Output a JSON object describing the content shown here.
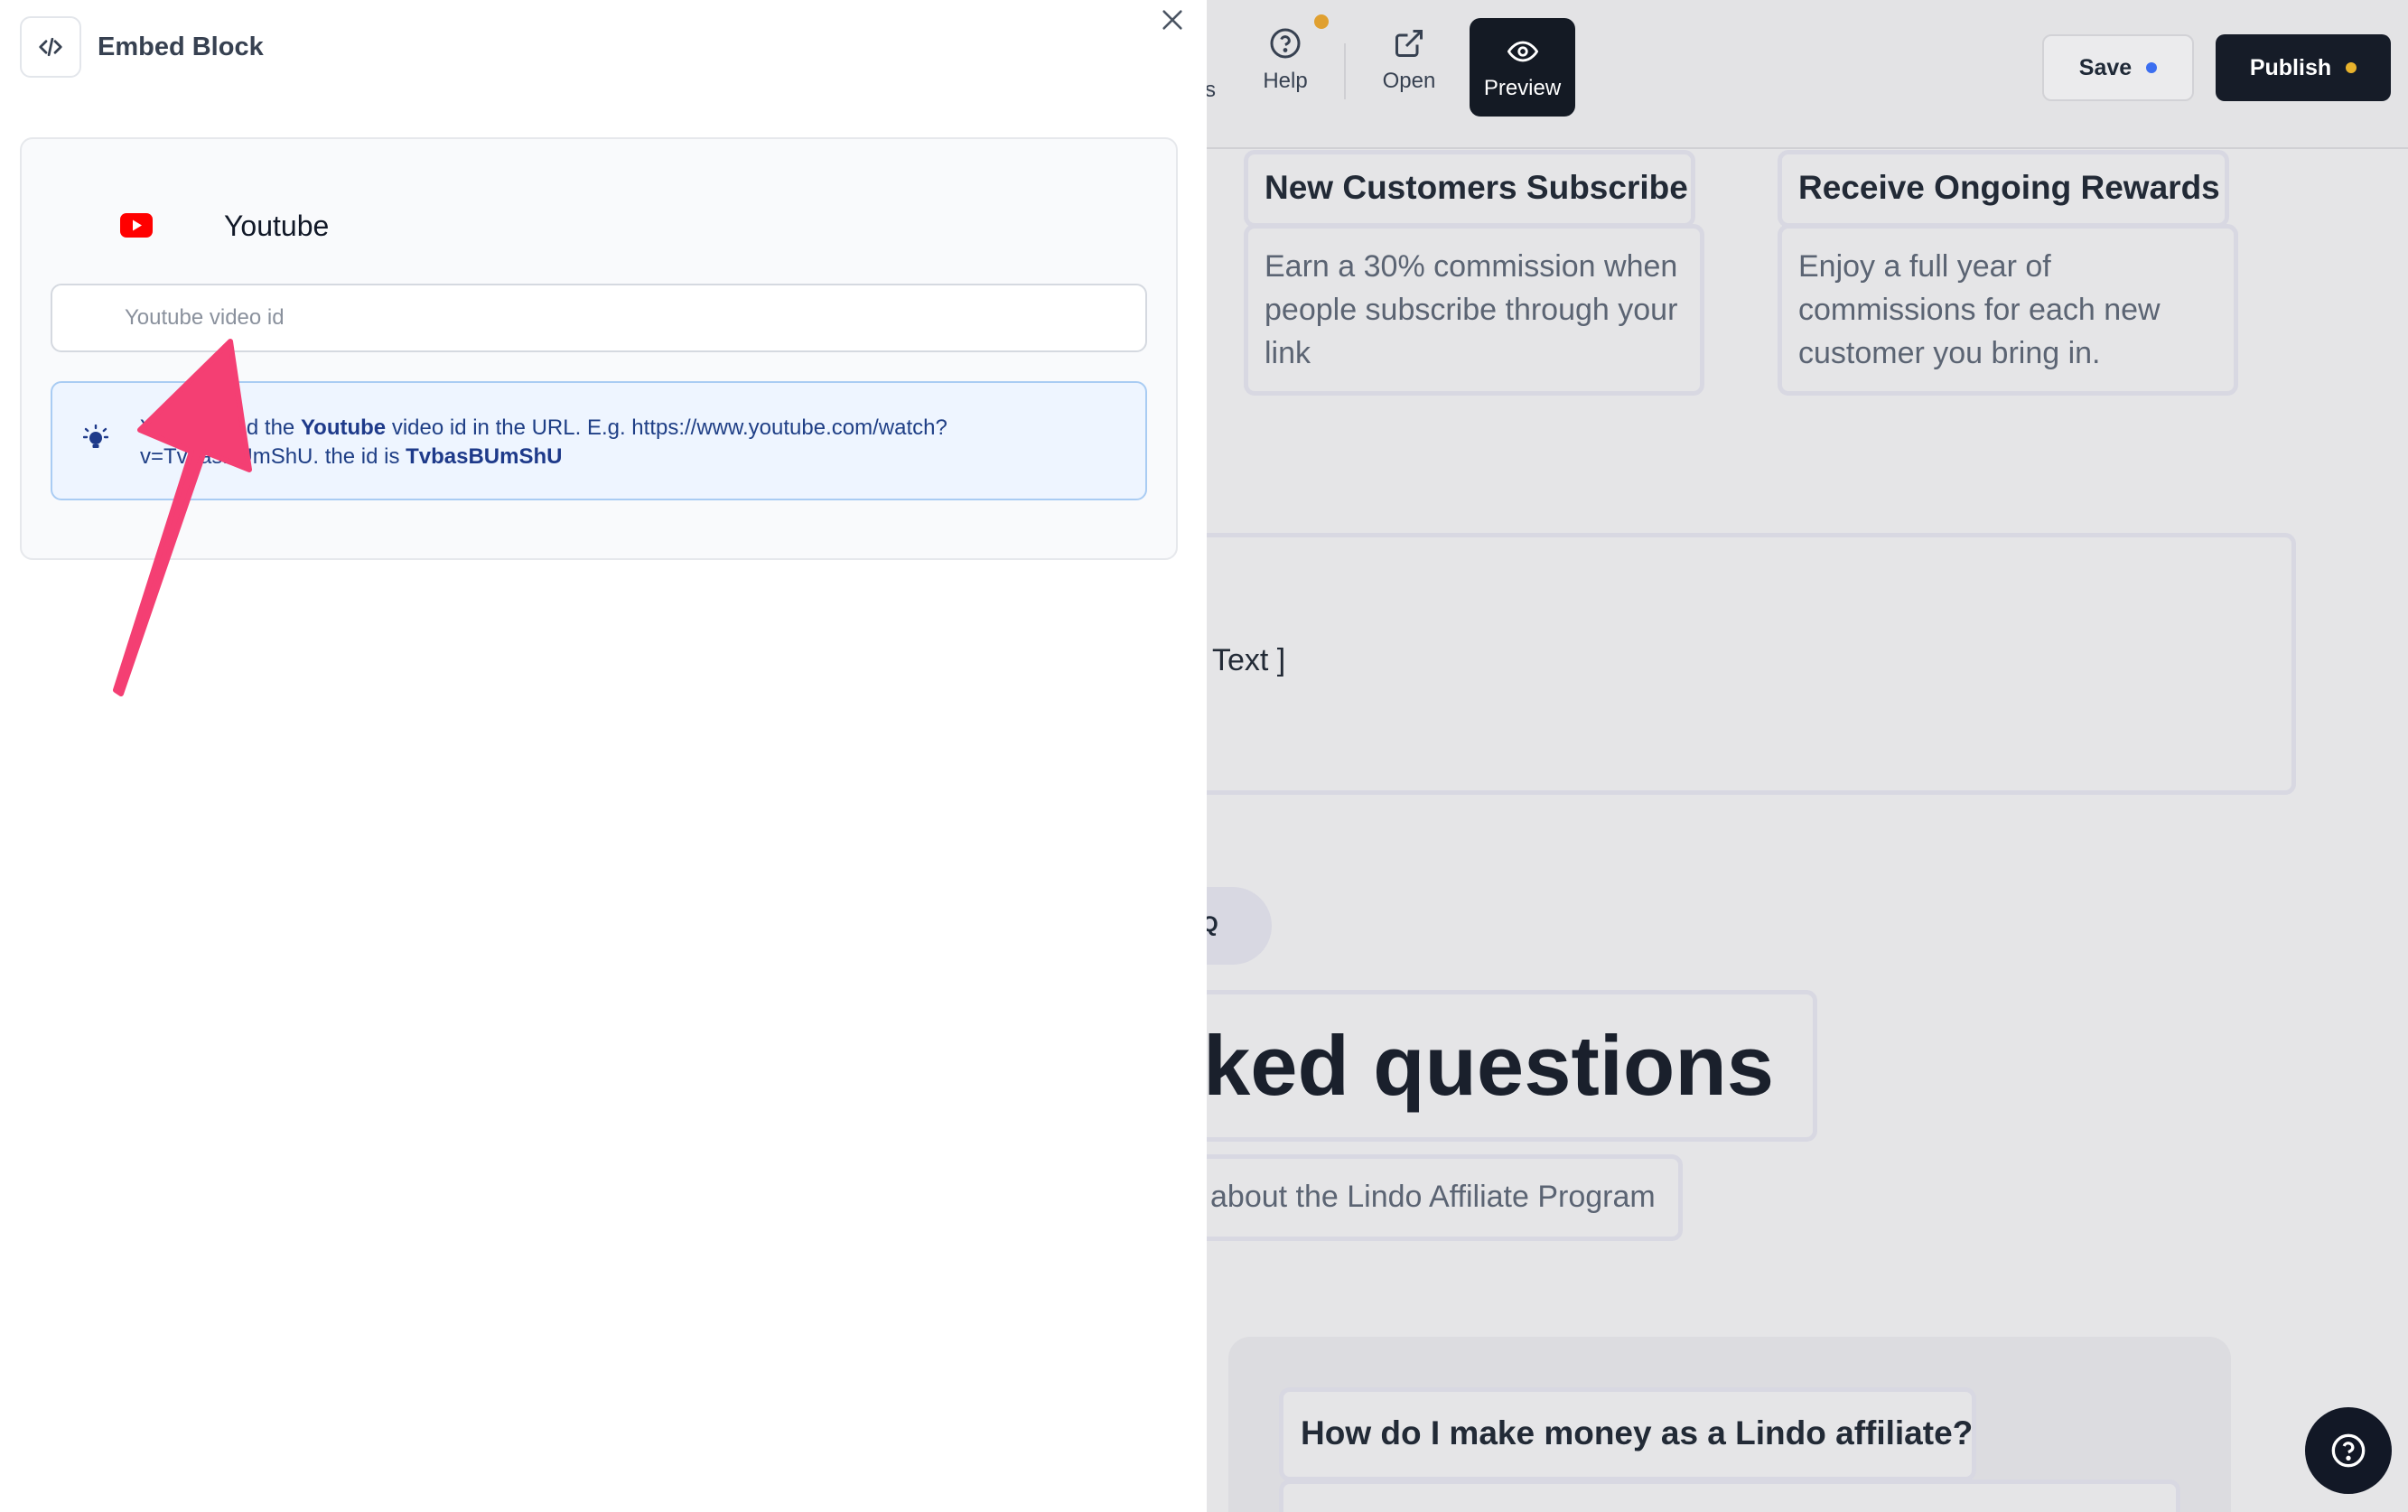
{
  "panel": {
    "title": "Embed Block",
    "embed_icon": "code-brackets-icon",
    "close_icon": "close-icon",
    "provider": {
      "label": "Youtube",
      "icon": "youtube-logo-icon",
      "color": "#ff0000"
    },
    "input": {
      "placeholder": "Youtube video id",
      "value": ""
    },
    "hint": {
      "icon": "lightbulb-icon",
      "prefix": "You can find the ",
      "provider_bold": "Youtube",
      "middle": " video id in the URL. E.g. https://www.youtube.com/watch?v=TvbasBUmShU. the id is ",
      "id_bold": "TvbasBUmShU"
    },
    "annotation": {
      "icon": "pink-arrow-annotation",
      "color": "#f43f73"
    }
  },
  "toolbar": {
    "truncated_label": "s",
    "help_label": "Help",
    "open_label": "Open",
    "preview_label": "Preview",
    "save_label": "Save",
    "publish_label": "Publish",
    "icons": {
      "help": "question-circle-icon",
      "open": "external-link-icon",
      "preview": "eye-icon"
    },
    "colors": {
      "save_dot": "#3b6ef0",
      "publish_dot": "#e8b22c",
      "notification_dot": "#e0a030"
    }
  },
  "canvas": {
    "cards": [
      {
        "title": "New Customers Subscribe",
        "body": "Earn a 30% commission when people subscribe through your link"
      },
      {
        "title": "Receive Ongoing Rewards",
        "body": "Enjoy a full year of commissions for each new customer you bring in."
      }
    ],
    "text_block_label": "Text ]",
    "faq_pill_label": "Q",
    "faq_heading": "ked questions",
    "faq_subtitle": "about the Lindo Affiliate Program",
    "faq_question": "How do I make money as a Lindo affiliate?",
    "help_fab_icon": "question-circle-icon"
  }
}
